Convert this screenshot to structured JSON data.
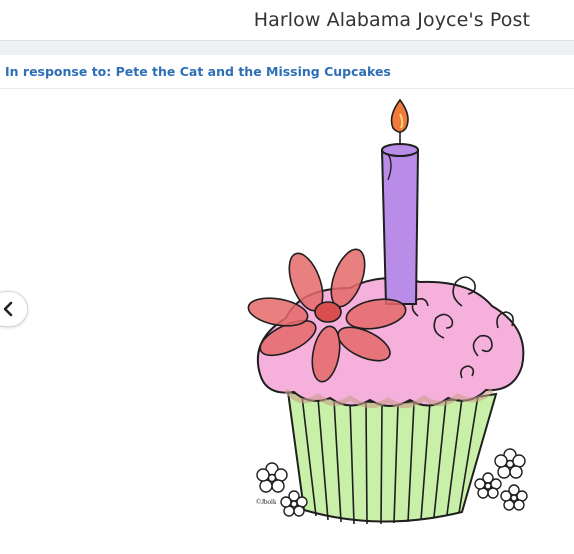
{
  "header": {
    "title": "Harlow Alabama Joyce's Post"
  },
  "response": {
    "text": "In response to: Pete the Cat and the Missing Cupcakes"
  },
  "navigation": {
    "previous_icon": "chevron-left-icon"
  },
  "artwork": {
    "subject": "cupcake drawing",
    "signature": "©Jbolk",
    "colors": {
      "frosting": "#f5b0dc",
      "candle": "#b98ce8",
      "flame": "#f07a3a",
      "flower": "#e56a6a",
      "liner": "#c8f0a8"
    }
  },
  "colors": {
    "link": "#2f6fb8",
    "title": "#333333",
    "band": "#eef0f3"
  }
}
